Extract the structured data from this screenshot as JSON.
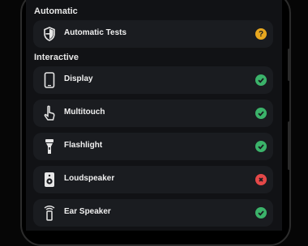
{
  "sections": {
    "automatic": "Automatic",
    "interactive": "Interactive"
  },
  "rows": [
    {
      "label": "Automatic Tests",
      "icon": "shield-icon",
      "status": "unknown",
      "status_glyph": "?"
    },
    {
      "label": "Display",
      "icon": "phone-icon",
      "status": "pass"
    },
    {
      "label": "Multitouch",
      "icon": "touch-hand-icon",
      "status": "pass"
    },
    {
      "label": "Flashlight",
      "icon": "flashlight-icon",
      "status": "pass"
    },
    {
      "label": "Loudspeaker",
      "icon": "speaker-icon",
      "status": "fail"
    },
    {
      "label": "Ear Speaker",
      "icon": "ear-speaker-icon",
      "status": "pass"
    }
  ],
  "colors": {
    "pass": "#3bb36a",
    "fail": "#e54848",
    "unknown": "#e7a71f",
    "background": "#111215",
    "card": "#1a1c20"
  }
}
